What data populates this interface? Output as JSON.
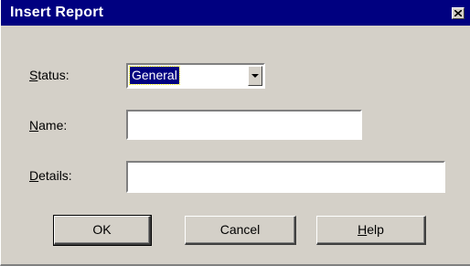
{
  "window": {
    "title": "Insert Report",
    "close_icon": "close-icon"
  },
  "form": {
    "status": {
      "label_mnemonic": "S",
      "label_rest": "tatus:",
      "selected_value": "General"
    },
    "name": {
      "label_mnemonic": "N",
      "label_rest": "ame:",
      "value": ""
    },
    "details": {
      "label_mnemonic": "D",
      "label_rest": "etails:",
      "value": ""
    }
  },
  "buttons": {
    "ok_label": "OK",
    "cancel_label": "Cancel",
    "help_mnemonic": "H",
    "help_rest": "elp"
  },
  "colors": {
    "titlebar": "#000080",
    "dialog_face": "#d4d0c8",
    "selection": "#000080"
  }
}
